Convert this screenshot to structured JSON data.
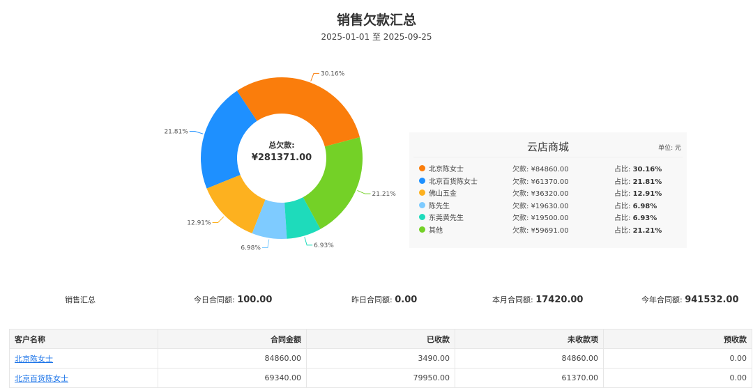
{
  "title": "销售欠款汇总",
  "date_range": "2025-01-01 至 2025-09-25",
  "center": {
    "label": "总欠款:",
    "value": "¥281371.00"
  },
  "panel": {
    "title": "云店商城",
    "unit": "单位: 元"
  },
  "chart_data": {
    "type": "pie",
    "subtype": "donut",
    "title": "销售欠款汇总",
    "total": 281371.0,
    "categories": [
      "北京陈女士",
      "北京百货陈女士",
      "佛山五金",
      "陈先生",
      "东莞黄先生",
      "其他"
    ],
    "values": [
      84860,
      61370,
      36320,
      19630,
      19500,
      59691
    ],
    "percent_labels": [
      "30.16%",
      "21.81%",
      "12.91%",
      "6.98%",
      "6.93%",
      "21.21%"
    ],
    "colors": [
      "#fa7d0c",
      "#1e90ff",
      "#fdb11f",
      "#7ecbff",
      "#1edbbb",
      "#74d127"
    ]
  },
  "legend": [
    {
      "name": "北京陈女士",
      "amount": "欠款: ¥84860.00",
      "pct_label": "占比: ",
      "pct": "30.16%"
    },
    {
      "name": "北京百货陈女士",
      "amount": "欠款: ¥61370.00",
      "pct_label": "占比: ",
      "pct": "21.81%"
    },
    {
      "name": "佛山五金",
      "amount": "欠款: ¥36320.00",
      "pct_label": "占比: ",
      "pct": "12.91%"
    },
    {
      "name": "陈先生",
      "amount": "欠款: ¥19630.00",
      "pct_label": "占比: ",
      "pct": "6.98%"
    },
    {
      "name": "东莞黄先生",
      "amount": "欠款: ¥19500.00",
      "pct_label": "占比: ",
      "pct": "6.93%"
    },
    {
      "name": "其他",
      "amount": "欠款: ¥59691.00",
      "pct_label": "占比: ",
      "pct": "21.21%"
    }
  ],
  "summary": {
    "label": "销售汇总",
    "today_label": "今日合同额:",
    "today": "100.00",
    "yesterday_label": "昨日合同额:",
    "yesterday": "0.00",
    "month_label": "本月合同额:",
    "month": "17420.00",
    "year_label": "今年合同额:",
    "year": "941532.00"
  },
  "table": {
    "headers": [
      "客户名称",
      "合同金额",
      "已收款",
      "未收款项",
      "预收款"
    ],
    "rows": [
      [
        "北京陈女士",
        "84860.00",
        "3490.00",
        "84860.00",
        "0.00"
      ],
      [
        "北京百货陈女士",
        "69340.00",
        "79950.00",
        "61370.00",
        "0.00"
      ]
    ]
  }
}
